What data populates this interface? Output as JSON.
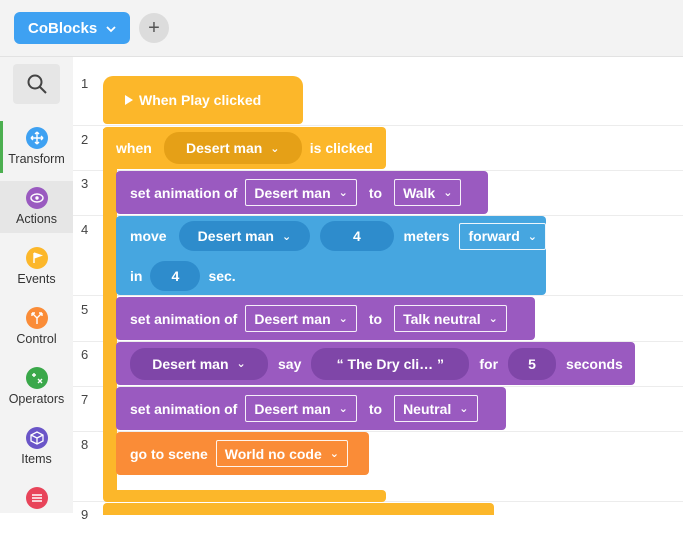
{
  "toolbar": {
    "project_label": "CoBlocks",
    "add_label": "+"
  },
  "sidebar": {
    "categories": [
      {
        "label": "Transform",
        "color": "#3ea1f2"
      },
      {
        "label": "Actions",
        "color": "#9a5ac0"
      },
      {
        "label": "Events",
        "color": "#fcb72a"
      },
      {
        "label": "Control",
        "color": "#fa8c37"
      },
      {
        "label": "Operators",
        "color": "#3aa84a"
      },
      {
        "label": "Items",
        "color": "#6a55c8"
      },
      {
        "label": "",
        "color": "#e8445a"
      }
    ],
    "active": "Actions"
  },
  "lines": [
    "1",
    "2",
    "3",
    "4",
    "5",
    "6",
    "7",
    "8",
    "9"
  ],
  "blocks": {
    "b1": {
      "label": "When Play clicked"
    },
    "b2": {
      "when": "when",
      "target": "Desert man",
      "tail": "is clicked"
    },
    "b3": {
      "label": "set animation of",
      "target": "Desert man",
      "to": "to",
      "value": "Walk"
    },
    "b4": {
      "move": "move",
      "target": "Desert man",
      "amount": "4",
      "unit": "meters",
      "direction": "forward",
      "in": "in",
      "time": "4",
      "sec": "sec."
    },
    "b5": {
      "label": "set animation of",
      "target": "Desert man",
      "to": "to",
      "value": "Talk neutral"
    },
    "b6": {
      "target": "Desert man",
      "say": "say",
      "text": "“  The Dry cli…  ”",
      "for": "for",
      "duration": "5",
      "seconds": "seconds"
    },
    "b7": {
      "label": "set animation of",
      "target": "Desert man",
      "to": "to",
      "value": "Neutral"
    },
    "b8": {
      "label": "go to scene",
      "value": "World no code"
    }
  }
}
